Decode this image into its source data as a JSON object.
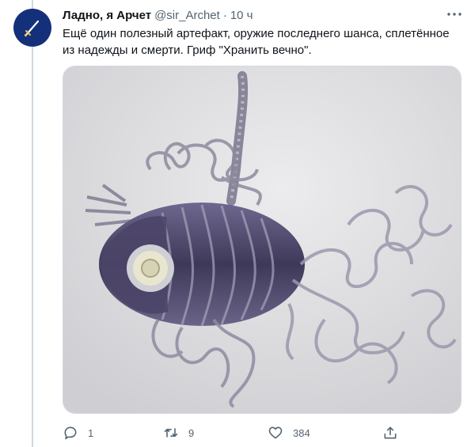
{
  "tweet": {
    "author_name": "Ладно, я Арчет",
    "handle": "@sir_Archet",
    "separator": "·",
    "time": "10 ч",
    "text_line1": "Ещё один полезный артефакт, оружие последнего шанса, сплетённое",
    "text_line2": "из надежды и смерти. Гриф \"Хранить вечно\".",
    "image_icon": "fish-skeleton-sculpture-photo"
  },
  "actions": {
    "reply_count": "1",
    "retweet_count": "9",
    "like_count": "384"
  },
  "colors": {
    "avatar_bg": "#15307a",
    "muted": "#536471",
    "text": "#0f1419",
    "photo_bg": "#e3e3e5",
    "sculpture": "#5a5474"
  },
  "icons": [
    "avatar-sword-icon",
    "more-icon",
    "reply-icon",
    "retweet-icon",
    "like-icon",
    "share-icon"
  ]
}
